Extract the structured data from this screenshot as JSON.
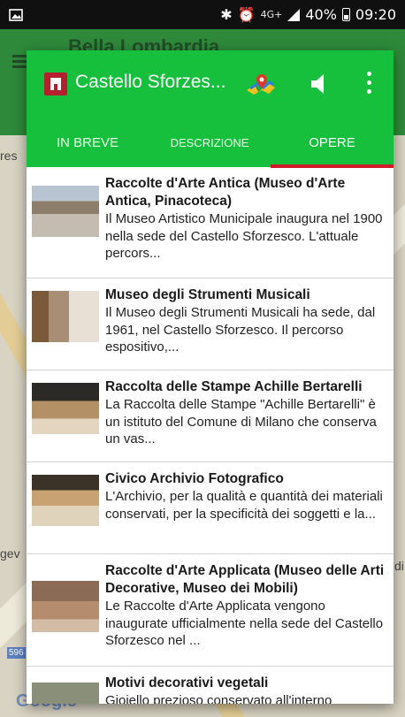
{
  "status_bar": {
    "network": "4G+",
    "battery": "40%",
    "time": "09:20"
  },
  "background": {
    "title": "Bella Lombardia",
    "map_labels": [
      "res",
      "gev",
      "596",
      "di"
    ],
    "google": "Google"
  },
  "dialog": {
    "title": "Castello Sforzes...",
    "tabs": [
      {
        "label": "IN BREVE"
      },
      {
        "label": "DESCRIZIONE"
      },
      {
        "label": "OPERE"
      }
    ],
    "active_tab": "OPERE",
    "colors": {
      "toolbar": "#16c03c",
      "indicator": "#d11a2a"
    },
    "items": [
      {
        "title": "Raccolte d'Arte Antica (Museo d'Arte Antica, Pinacoteca)",
        "description": "Il Museo Artistico Municipale inaugura nel 1900 nella sede del Castello Sforzesco. L'attuale percors..."
      },
      {
        "title": "Museo degli Strumenti Musicali",
        "description": "Il Museo degli Strumenti Musicali ha sede, dal 1961, nel Castello Sforzesco. Il percorso espositivo,..."
      },
      {
        "title": "Raccolta delle Stampe Achille Bertarelli",
        "description": "La Raccolta delle Stampe \"Achille Bertarelli\" è un istituto del Comune di Milano che conserva un vas..."
      },
      {
        "title": "Civico Archivio Fotografico",
        "description": "L'Archivio, per la qualità e quantità dei materiali conservati, per la specificità dei soggetti e la..."
      },
      {
        "title": "Raccolte d'Arte Applicata (Museo delle Arti Decorative, Museo dei Mobili)",
        "description": "Le Raccolte d'Arte Applicata vengono inaugurate ufficialmente nella sede del Castello Sforzesco nel ..."
      },
      {
        "title": "Motivi decorativi vegetali",
        "description": "Gioiello prezioso conservato all'interno"
      }
    ]
  }
}
